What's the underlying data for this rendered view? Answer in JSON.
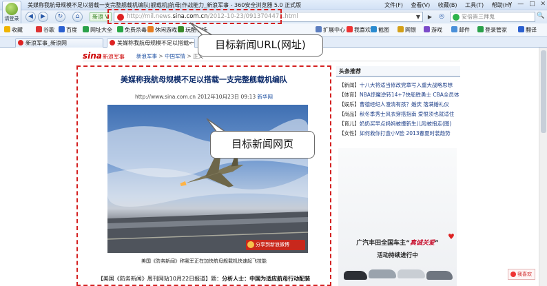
{
  "titlebar": {
    "login_label": "请登录",
    "title": "美媒称我航母规模不足以搭载一支完整舰载机编队|舰载机|航母|作战能力_新浪军事 - 360安全浏览器 5.0 正式版",
    "menus": [
      "文件(F)",
      "查看(V)",
      "收藏(B)",
      "工具(T)",
      "帮助(H)"
    ],
    "window_buttons": [
      "v",
      "—",
      "□",
      "✕"
    ]
  },
  "navbar": {
    "back_icon": "◀",
    "forward_icon": "▶",
    "refresh_icon": "↻",
    "home_icon": "⌂",
    "new_tag": "新浪 V",
    "url_host": "http://mil.news.",
    "url_domain": "sina.com.cn",
    "url_path": "/2012-10-23/0913704471.html",
    "dropdown": "▼",
    "go": "▶",
    "search_placeholder": "安倍晋三拜鬼",
    "search_icon": "🔍"
  },
  "favbar": {
    "items": [
      "收藏",
      "谷歌",
      "百度",
      "网址大全",
      "免费杀毒",
      "休闲游戏",
      "玩酷农场"
    ],
    "right_items": [
      "扩展中心",
      "我喜欢",
      "截图",
      "网银",
      "游戏",
      "邮件",
      "翻译",
      "登录管家",
      "翻译"
    ]
  },
  "tabs": [
    {
      "label": "新浪军事_新浪网",
      "active": false
    },
    {
      "label": "美媒称我航母规模不足以搭载一…",
      "active": true
    }
  ],
  "newtab": "+",
  "page": {
    "logo": "sina",
    "logo_sub": "新浪军事",
    "breadcrumb_home": "新浪军事",
    "breadcrumb_sep1": " > ",
    "breadcrumb_sec": "中国军情",
    "breadcrumb_sep2": " > ",
    "breadcrumb_cur": "正文",
    "headline": "美媒称我航母规模不足以搭载一支完整舰载机编队",
    "meta_prefix": "http://www.sina.com.cn  2012年10月23日 09:13 ",
    "meta_source": "新华网",
    "share_label": "分享到新浪微博",
    "caption": "美国《防务新闻》称我军正在加快航母舰载机快速起飞技能",
    "body_prefix": "【美国《防务新闻》周刊网站10月22日报道】题：",
    "body_bold": "分析人士：中国为适应航母行动配装"
  },
  "sidebar": {
    "heading": "头条推荐",
    "items": [
      {
        "tag": "【新闻】",
        "text": "十八大将适当修改党章写入重大战略思想"
      },
      {
        "tag": "【体育】",
        "text": "NBA惊魔逆转14+7快船胜勇士 CBA全员体训"
      },
      {
        "tag": "【娱乐】",
        "text": "曹德经纪人澄清有孩？婚庆 落满婚礼仪"
      },
      {
        "tag": "【尚品】",
        "text": "秋冬季秀士风衣穿搭指南 爱恨须也就适住"
      },
      {
        "tag": "【育儿】",
        "text": "奶奶买早点妈妈被撞新生儿险被抱走(图)"
      },
      {
        "tag": "【女性】",
        "text": "如何救你打造小V脸 2013春夏时装趋势"
      }
    ],
    "ad_title_before": "广汽丰田全国车主“",
    "ad_title_highlight": "真诚关爱",
    "ad_title_after": "”",
    "ad_sub": "活动持续进行中"
  },
  "like_button": "我喜欢",
  "annotations": {
    "url_callout": "目标新闻URL(网址)",
    "page_callout": "目标新闻网页"
  },
  "colors": {
    "accent": "#d42020",
    "link": "#1e50a2",
    "headline": "#0b2a6a",
    "brand": "#c00000"
  }
}
